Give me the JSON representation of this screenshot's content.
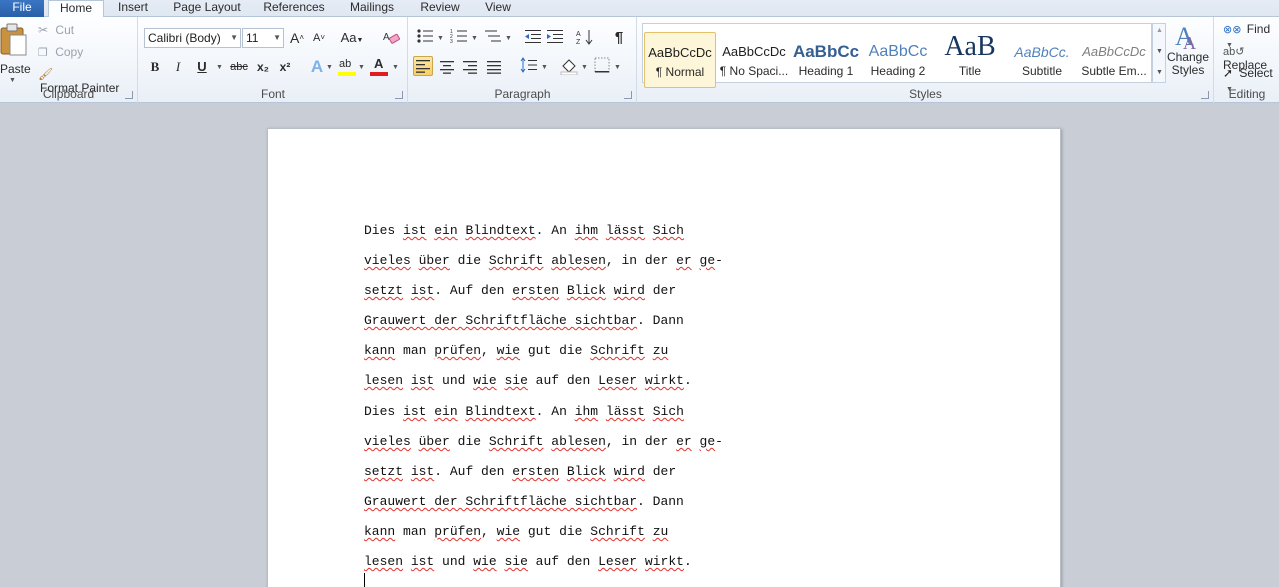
{
  "tabs": [
    "File",
    "Home",
    "Insert",
    "Page Layout",
    "References",
    "Mailings",
    "Review",
    "View"
  ],
  "clipboard": {
    "paste": "Paste",
    "cut": "Cut",
    "copy": "Copy",
    "format_painter": "Format Painter",
    "group": "Clipboard"
  },
  "font": {
    "name": "Calibri (Body)",
    "size": "11",
    "group": "Font",
    "grow_icon": "A",
    "shrink_icon": "A",
    "case_icon": "Aa",
    "bold": "B",
    "italic": "I",
    "underline": "U",
    "strike": "abc",
    "subscript": "x₂",
    "superscript": "x²",
    "highlight_text": "ab",
    "font_color_text": "A",
    "text_effects": "A",
    "highlight_color": "#ffff00",
    "font_color": "#e11e1e"
  },
  "paragraph": {
    "group": "Paragraph",
    "show_marks": "¶"
  },
  "styles": {
    "group": "Styles",
    "items": [
      {
        "preview": "AaBbCcDc",
        "name": "¶ Normal"
      },
      {
        "preview": "AaBbCcDc",
        "name": "¶ No Spaci..."
      },
      {
        "preview": "AaBbCc",
        "name": "Heading 1"
      },
      {
        "preview": "AaBbCc",
        "name": "Heading 2"
      },
      {
        "preview": "AaB",
        "name": "Title"
      },
      {
        "preview": "AaBbCc.",
        "name": "Subtitle"
      },
      {
        "preview": "AaBbCcDc",
        "name": "Subtle Em..."
      }
    ],
    "change_styles": "Change Styles"
  },
  "editing": {
    "group": "Editing",
    "find": "Find",
    "replace": "Replace",
    "select": "Select"
  },
  "document": {
    "lines": [
      [
        [
          "Dies ",
          0
        ],
        [
          "ist",
          1
        ],
        [
          " ",
          0
        ],
        [
          "ein",
          1
        ],
        [
          " ",
          0
        ],
        [
          "Blindtext",
          1
        ],
        [
          ". An ",
          0
        ],
        [
          "ihm",
          1
        ],
        [
          " ",
          0
        ],
        [
          "lässt",
          1
        ],
        [
          " ",
          0
        ],
        [
          "Sich",
          1
        ]
      ],
      [
        [
          "vieles",
          1
        ],
        [
          " ",
          0
        ],
        [
          "über",
          1
        ],
        [
          " die ",
          0
        ],
        [
          "Schrift",
          1
        ],
        [
          " ",
          0
        ],
        [
          "ablesen",
          1
        ],
        [
          ", in der ",
          0
        ],
        [
          "er",
          1
        ],
        [
          " ",
          0
        ],
        [
          "ge",
          1
        ],
        [
          "-",
          0
        ]
      ],
      [
        [
          "setzt",
          1
        ],
        [
          " ",
          0
        ],
        [
          "ist",
          1
        ],
        [
          ". Auf den ",
          0
        ],
        [
          "ersten",
          1
        ],
        [
          " ",
          0
        ],
        [
          "Blick",
          1
        ],
        [
          " ",
          0
        ],
        [
          "wird",
          1
        ],
        [
          " der",
          0
        ]
      ],
      [
        [
          "Grauwert der Schriftfläche sichtbar",
          1
        ],
        [
          ". Dann",
          0
        ]
      ],
      [
        [
          "kann",
          1
        ],
        [
          " man ",
          0
        ],
        [
          "prüfen",
          1
        ],
        [
          ", ",
          0
        ],
        [
          "wie",
          1
        ],
        [
          " gut die ",
          0
        ],
        [
          "Schrift",
          1
        ],
        [
          " ",
          0
        ],
        [
          "zu",
          1
        ]
      ],
      [
        [
          "lesen",
          1
        ],
        [
          " ",
          0
        ],
        [
          "ist",
          1
        ],
        [
          " und ",
          0
        ],
        [
          "wie",
          1
        ],
        [
          " ",
          0
        ],
        [
          "sie",
          1
        ],
        [
          " auf den ",
          0
        ],
        [
          "Leser",
          1
        ],
        [
          " ",
          0
        ],
        [
          "wirkt",
          1
        ],
        [
          ".",
          0
        ]
      ],
      [
        [
          "Dies ",
          0
        ],
        [
          "ist",
          1
        ],
        [
          " ",
          0
        ],
        [
          "ein",
          1
        ],
        [
          " ",
          0
        ],
        [
          "Blindtext",
          1
        ],
        [
          ". An ",
          0
        ],
        [
          "ihm",
          1
        ],
        [
          " ",
          0
        ],
        [
          "lässt",
          1
        ],
        [
          " ",
          0
        ],
        [
          "Sich",
          1
        ]
      ],
      [
        [
          "vieles",
          1
        ],
        [
          " ",
          0
        ],
        [
          "über",
          1
        ],
        [
          " die ",
          0
        ],
        [
          "Schrift",
          1
        ],
        [
          " ",
          0
        ],
        [
          "ablesen",
          1
        ],
        [
          ", in der ",
          0
        ],
        [
          "er",
          1
        ],
        [
          " ",
          0
        ],
        [
          "ge",
          1
        ],
        [
          "-",
          0
        ]
      ],
      [
        [
          "setzt",
          1
        ],
        [
          " ",
          0
        ],
        [
          "ist",
          1
        ],
        [
          ". Auf den ",
          0
        ],
        [
          "ersten",
          1
        ],
        [
          " ",
          0
        ],
        [
          "Blick",
          1
        ],
        [
          " ",
          0
        ],
        [
          "wird",
          1
        ],
        [
          " der",
          0
        ]
      ],
      [
        [
          "Grauwert der Schriftfläche sichtbar",
          1
        ],
        [
          ". Dann",
          0
        ]
      ],
      [
        [
          "kann",
          1
        ],
        [
          " man ",
          0
        ],
        [
          "prüfen",
          1
        ],
        [
          ", ",
          0
        ],
        [
          "wie",
          1
        ],
        [
          " gut die ",
          0
        ],
        [
          "Schrift",
          1
        ],
        [
          " ",
          0
        ],
        [
          "zu",
          1
        ]
      ],
      [
        [
          "lesen",
          1
        ],
        [
          " ",
          0
        ],
        [
          "ist",
          1
        ],
        [
          " und ",
          0
        ],
        [
          "wie",
          1
        ],
        [
          " ",
          0
        ],
        [
          "sie",
          1
        ],
        [
          " auf den ",
          0
        ],
        [
          "Leser",
          1
        ],
        [
          " ",
          0
        ],
        [
          "wirkt",
          1
        ],
        [
          ".",
          0
        ]
      ]
    ]
  }
}
